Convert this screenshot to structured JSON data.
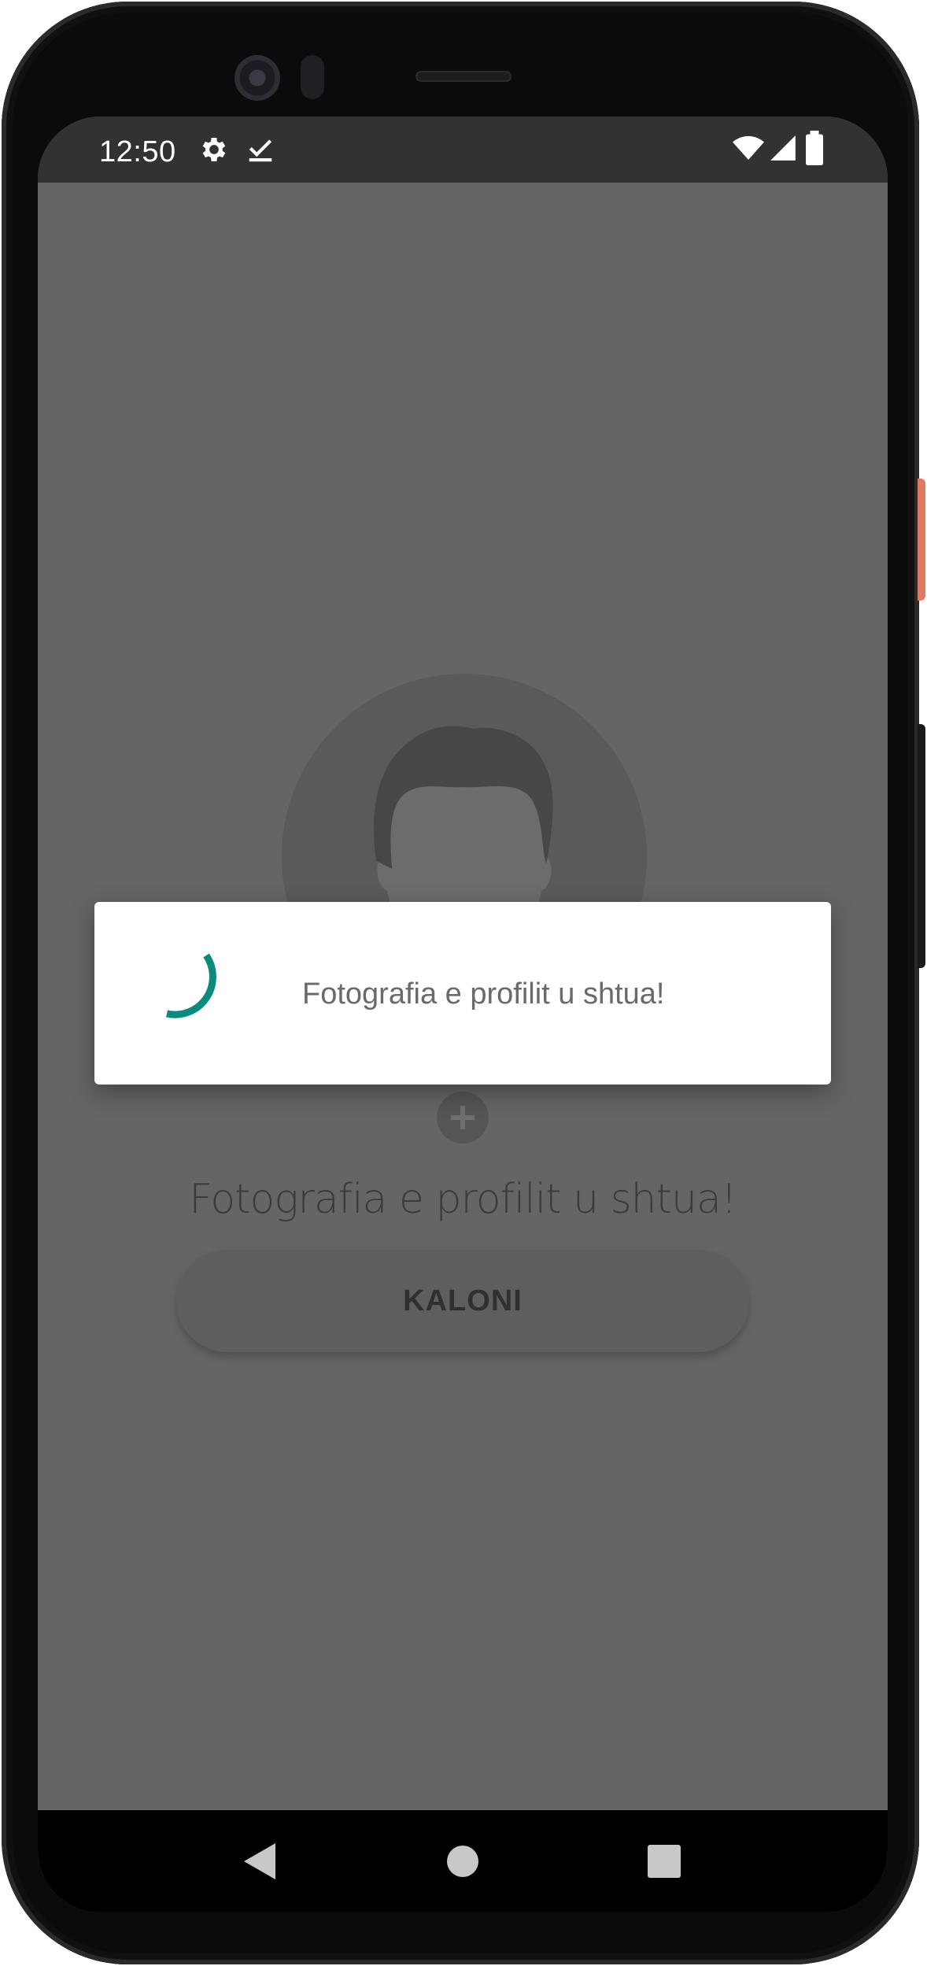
{
  "status_bar": {
    "time": "12:50",
    "left_icons": [
      "gear-icon",
      "download-done-icon"
    ],
    "right_icons": [
      "wifi-icon",
      "cellular-signal-icon",
      "battery-icon"
    ]
  },
  "profile": {
    "avatar_icon": "person-silhouette-icon",
    "add_icon": "plus-icon",
    "message": "Fotografia e profilit u shtua!",
    "next_button_label": "KALONI"
  },
  "dialog": {
    "message": "Fotografia e profilit u shtua!",
    "spinner_icon": "progress-spinner-icon",
    "accent_color": "#0b8a7e"
  },
  "nav_bar": {
    "icons": [
      "back-triangle-icon",
      "home-circle-icon",
      "recents-square-icon"
    ]
  },
  "colors": {
    "scrim": "#656565",
    "status_bar": "#323232",
    "dialog_bg": "#ffffff"
  }
}
